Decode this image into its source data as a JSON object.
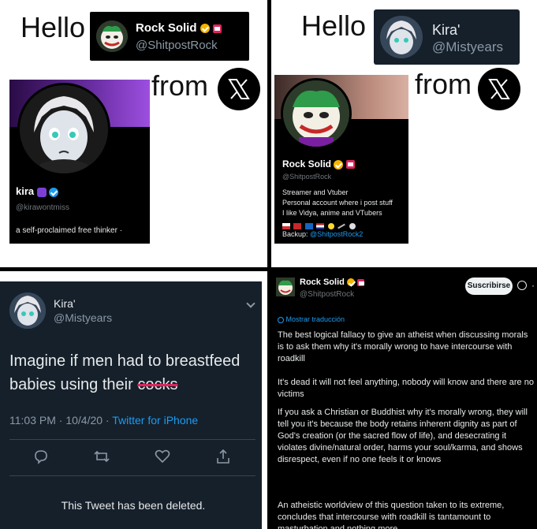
{
  "panel1": {
    "hello": "Hello",
    "from": "from",
    "chip": {
      "name": "Rock Solid",
      "handle": "@ShitpostRock"
    },
    "profile": {
      "name": "kira",
      "handle": "@kirawontmiss",
      "bio": "a self-proclaimed free thinker ·"
    }
  },
  "panel2": {
    "hello": "Hello",
    "from": "from",
    "chip": {
      "name": "Kira'",
      "handle": "@Mistyears"
    },
    "profile": {
      "name": "Rock Solid",
      "handle": "@ShitpostRock",
      "bio_lines": [
        "Streamer and Vtuber",
        "Personal account where i post stuff",
        "I like Vidya, anime and  VTubers"
      ],
      "backup_label": "Backup:",
      "backup_link": "@ShitpostRock2"
    }
  },
  "panel3": {
    "name": "Kira'",
    "handle": "@Mistyears",
    "text_line1": "Imagine if men had to breastfeed",
    "text_line2_start": "babies using their ",
    "text_struck": "cocks",
    "timestamp": "11:03 PM · 10/4/20 · ",
    "source": "Twitter for iPhone",
    "deleted_notice": "This Tweet has been deleted."
  },
  "panel4": {
    "name": "Rock Solid",
    "handle": "@ShitpostRock",
    "subscribe_label": "Suscribirse",
    "translate_label": "Mostrar traducción",
    "paragraphs": [
      "The best logical fallacy to give an atheist when discussing morals is to ask them why it's morally wrong to have intercourse with roadkill",
      "It's dead it will not feel anything, nobody will know and there are no victims",
      "If you ask a Christian or Buddhist why it's morally wrong, they will tell you it's because the body retains inherent dignity as part of God's creation (or the sacred flow of life), and desecrating it violates divine/natural order, harms your soul/karma, and shows disrespect, even if no one feels it or knows",
      "An atheistic worldview of this question taken to its extreme, concludes that intercourse with roadkill is tantamount to masturbation and nothing more"
    ]
  },
  "colors": {
    "twitter_dim": "#15202b",
    "twitter_black": "#000000",
    "link_blue": "#1d9bf0",
    "gold_badge": "#f4b400",
    "strike_red": "#e0245e"
  }
}
